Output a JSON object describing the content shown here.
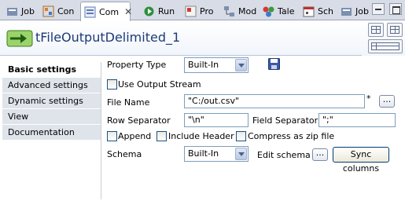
{
  "tabs": [
    {
      "label": "Job",
      "icon": "job-icon"
    },
    {
      "label": "Con",
      "icon": "contexts-icon"
    },
    {
      "label": "Com",
      "icon": "component-icon",
      "active": true
    },
    {
      "label": "Run",
      "icon": "run-icon"
    },
    {
      "label": "Pro",
      "icon": "problems-icon"
    },
    {
      "label": "Mod",
      "icon": "modules-icon"
    },
    {
      "label": "Tale",
      "icon": "talend-icon"
    },
    {
      "label": "Sch",
      "icon": "scheduler-icon"
    },
    {
      "label": "Job",
      "icon": "job-icon"
    }
  ],
  "tab_close_glyph": "✕",
  "component": {
    "title": "tFileOutputDelimited_1"
  },
  "nav": {
    "items": [
      "Basic settings",
      "Advanced settings",
      "Dynamic settings",
      "View",
      "Documentation"
    ]
  },
  "form": {
    "property_type_label": "Property Type",
    "property_type_value": "Built-In",
    "use_output_stream_label": "Use Output Stream",
    "file_name_label": "File Name",
    "file_name_value": "\"C:/out.csv\"",
    "file_name_marker": "*",
    "row_separator_label": "Row Separator",
    "row_separator_value": "\"\\n\"",
    "field_separator_label": "Field Separator",
    "field_separator_value": "\";\"",
    "append_label": "Append",
    "include_header_label": "Include Header",
    "compress_label": "Compress as zip file",
    "schema_label": "Schema",
    "schema_value": "Built-In",
    "edit_schema_label": "Edit schema",
    "sync_columns_label": "Sync columns",
    "dots_glyph": "..."
  },
  "colors": {
    "title": "#1d3a78",
    "tabstrip": "#d7dce6",
    "nav_bg": "#dfe3ea"
  }
}
